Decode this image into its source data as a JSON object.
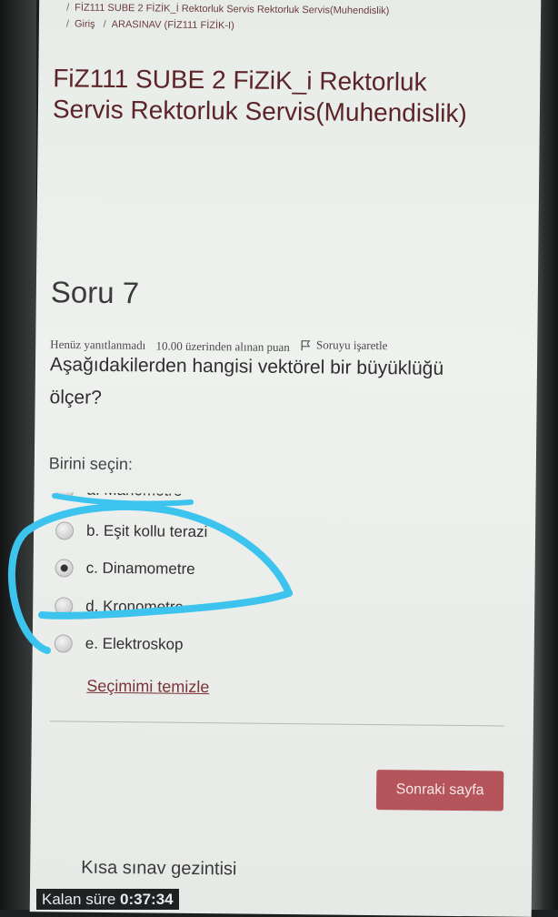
{
  "breadcrumb": {
    "course": "FİZ111 SUBE 2 FİZİK_İ Rektorluk Servis Rektorluk Servis(Muhendislik)",
    "home": "Giriş",
    "quiz": "ARASINAV (FİZ111 FİZİK-I)"
  },
  "course_title": "FiZ111 SUBE 2 FiZiK_i Rektorluk Servis Rektorluk Servis(Muhendislik)",
  "question": {
    "heading": "Soru 7",
    "status": "Henüz yanıtlanmadı",
    "grade": "10.00 üzerinden alınan puan",
    "flag_label": "Soruyu işaretle",
    "text": "Aşağıdakilerden hangisi vektörel bir büyüklüğü ölçer?",
    "prompt": "Birini seçin:",
    "options": [
      {
        "label": "a. Manometre",
        "checked": false
      },
      {
        "label": "b. Eşit kollu terazi",
        "checked": false
      },
      {
        "label": "c. Dinamometre",
        "checked": true
      },
      {
        "label": "d. Kronometre",
        "checked": false
      },
      {
        "label": "e. Elektroskop",
        "checked": false
      }
    ],
    "clear_choice": "Seçimimi temizle"
  },
  "next_button": "Sonraki sayfa",
  "quiz_navigation": "Kısa sınav gezintisi",
  "timer": {
    "label": "Kalan süre",
    "value": "0:37:34"
  },
  "colors": {
    "brand": "#5b2428",
    "button": "#b5545b",
    "annotation": "#3cc3ee"
  }
}
